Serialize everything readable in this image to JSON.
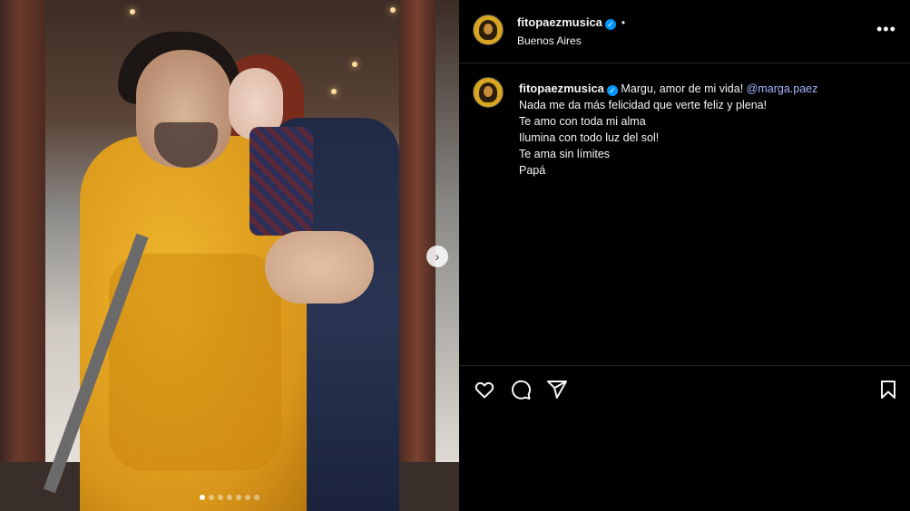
{
  "post": {
    "username": "fitopaezmusica",
    "verified_mark": "✓",
    "header_separator": "•",
    "location": "Buenos Aires",
    "more_glyph": "•••",
    "carousel": {
      "total_slides": 7,
      "active_index": 0,
      "next_glyph": "›"
    }
  },
  "caption": {
    "username": "fitopaezmusica",
    "line1_text": "Margu, amor de mi vida!",
    "mention": "@marga.paez",
    "lines": [
      "Nada me da más felicidad que verte feliz y plena!",
      "Te amo con toda mi alma",
      "Ilumina con todo luz del sol!",
      "Te ama sin límites",
      "Papá"
    ]
  },
  "actions": {
    "icons": [
      "heart-icon",
      "comment-icon",
      "share-icon",
      "bookmark-icon"
    ]
  },
  "colors": {
    "background": "#000000",
    "verified": "#0095f6",
    "mention": "#a8b5ff",
    "divider": "#262626"
  }
}
